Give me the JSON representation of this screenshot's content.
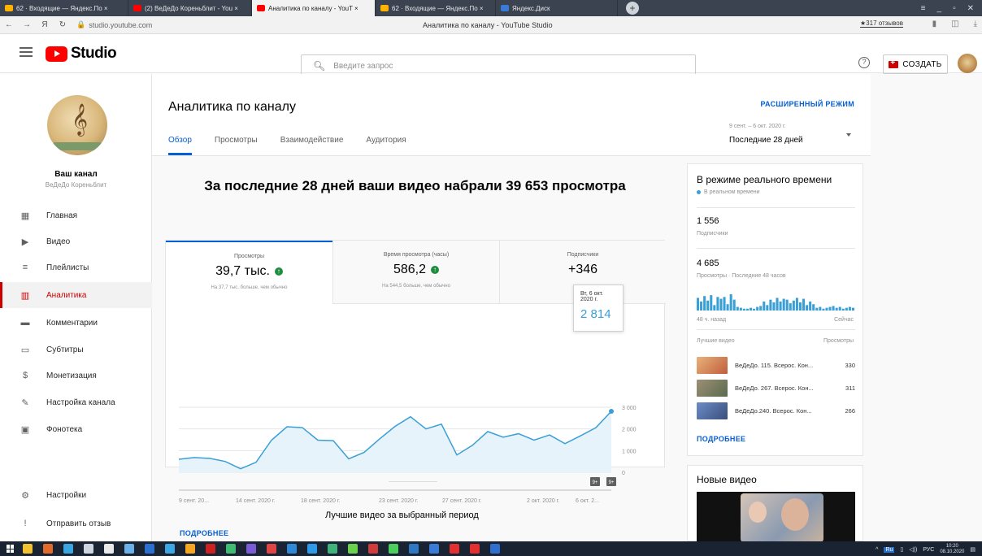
{
  "browser": {
    "tabs": [
      {
        "label": "62 · Входящие — Яндекс.По ×",
        "color": "#ffb300"
      },
      {
        "label": "(2) ВеДеДо Кореньблит - You ×",
        "color": "#ff0000"
      },
      {
        "label": "Аналитика по каналу - YouT ×",
        "color": "#ff0000",
        "active": true
      },
      {
        "label": "62 · Входящие — Яндекс.По ×",
        "color": "#ffb300"
      },
      {
        "label": "Яндекс.Диск",
        "color": "#3a7bd5"
      }
    ],
    "url": "studio.youtube.com",
    "page_title": "Аналитика по каналу - YouTube Studio",
    "reviews": "★317 отзывов"
  },
  "header": {
    "logo_text": "Studio",
    "search_placeholder": "Введите запрос",
    "create_label": "СОЗДАТЬ"
  },
  "sidebar": {
    "channel_title": "Ваш канал",
    "channel_name": "ВеДеДо Кореньблит",
    "items": [
      {
        "label": "Главная",
        "icon": "dashboard-icon"
      },
      {
        "label": "Видео",
        "icon": "video-icon"
      },
      {
        "label": "Плейлисты",
        "icon": "playlist-icon"
      },
      {
        "label": "Аналитика",
        "icon": "analytics-icon",
        "active": true
      },
      {
        "label": "Комментарии",
        "icon": "comments-icon"
      },
      {
        "label": "Субтитры",
        "icon": "subtitles-icon"
      },
      {
        "label": "Монетизация",
        "icon": "monetization-icon"
      },
      {
        "label": "Настройка канала",
        "icon": "customization-icon"
      },
      {
        "label": "Фонотека",
        "icon": "audio-library-icon"
      }
    ],
    "bottom_items": [
      {
        "label": "Настройки",
        "icon": "settings-icon"
      },
      {
        "label": "Отправить отзыв",
        "icon": "feedback-icon"
      }
    ]
  },
  "main": {
    "title": "Аналитика по каналу",
    "advanced_mode": "РАСШИРЕННЫЙ РЕЖИМ",
    "tabs": [
      "Обзор",
      "Просмотры",
      "Взаимодействие",
      "Аудитория"
    ],
    "date_range_small": "9 сент. – 6 окт. 2020 г.",
    "date_range_label": "Последние 28 дней",
    "summary": "За последние 28 дней ваши видео набрали 39 653 просмотра",
    "metrics": [
      {
        "label": "Просмотры",
        "value": "39,7 тыс.",
        "note": "На 37,7 тыс. больше, чем обычно"
      },
      {
        "label": "Время просмотра (часы)",
        "value": "586,2",
        "note": "На 544,5 больше, чем обычно"
      },
      {
        "label": "Подписчики",
        "value": "+346",
        "note": ""
      }
    ],
    "more_label": "ПОДРОБНЕЕ",
    "tooltip": {
      "date": "Вт, 6 окт. 2020 г.",
      "value": "2 814"
    },
    "top_videos_title": "Лучшие видео за выбранный период"
  },
  "chart_data": {
    "type": "area",
    "x_tick_labels": [
      "9 сент. 20...",
      "14 сент. 2020 г.",
      "18 сент. 2020 г.",
      "23 сент. 2020 г.",
      "27 сент. 2020 г.",
      "2 окт. 2020 г.",
      "6 окт. 2..."
    ],
    "y_tick_labels": [
      "0",
      "1 000",
      "2 000",
      "3 000"
    ],
    "ylim": [
      0,
      3000
    ],
    "values": [
      600,
      680,
      640,
      500,
      160,
      460,
      1480,
      2100,
      2060,
      1480,
      1460,
      620,
      920,
      1540,
      2120,
      2560,
      2000,
      2220,
      800,
      1240,
      1880,
      1620,
      1780,
      1480,
      1720,
      1320,
      1680,
      2060,
      2814
    ],
    "badges": [
      "9+",
      "9+"
    ],
    "color": "#3a9fd5",
    "fill": "#e6f3fa"
  },
  "realtime": {
    "title": "В режиме реального времени",
    "live": "В реальном времени",
    "subscribers": "1 556",
    "subscribers_label": "Подписчики",
    "views": "4 685",
    "views_label": "Просмотры · Последние 48 часов",
    "bars": [
      14,
      10,
      16,
      11,
      17,
      6,
      15,
      13,
      15,
      7,
      18,
      12,
      4,
      3,
      2,
      2,
      3,
      2,
      4,
      5,
      10,
      6,
      12,
      9,
      14,
      10,
      13,
      12,
      8,
      11,
      14,
      9,
      13,
      6,
      10,
      7,
      3,
      4,
      2,
      3,
      4,
      5,
      3,
      4,
      2,
      3,
      4,
      3
    ],
    "ago_label": "48 ч. назад",
    "now_label": "Сейчас",
    "top_videos_label": "Лучшие видео",
    "views_col_label": "Просмотры",
    "videos": [
      {
        "title": "ВеДеДо. 115. Всерос. Кон...",
        "views": "330",
        "thumb": "#d38a55"
      },
      {
        "title": "ВеДеДо. 267. Всерос. Кон...",
        "views": "311",
        "thumb": "#7a6e5a"
      },
      {
        "title": "ВеДеДо.240. Всерос. Кон...",
        "views": "266",
        "thumb": "#5f7aa8"
      }
    ],
    "more_label": "ПОДРОБНЕЕ"
  },
  "new_videos": {
    "title": "Новые видео"
  },
  "taskbar": {
    "lang": "Ru",
    "input": "РУС",
    "time": "10:20",
    "date": "08.10.2020",
    "icons": [
      "#f2c230",
      "#e26b2b",
      "#3ba7e0",
      "#cfd5de",
      "#e9e9e9",
      "#6bb0e8",
      "#2b6fd1",
      "#3ca7e5",
      "#f5a623",
      "#cf2020",
      "#3fbb72",
      "#7c5cd6",
      "#e04545",
      "#2e89d8",
      "#2f9be8",
      "#3fb37a",
      "#6bd04c",
      "#d23b3b",
      "#4bce5c",
      "#2e78c4",
      "#3a7bd5",
      "#e23030",
      "#e23030",
      "#2f6fcf"
    ]
  }
}
